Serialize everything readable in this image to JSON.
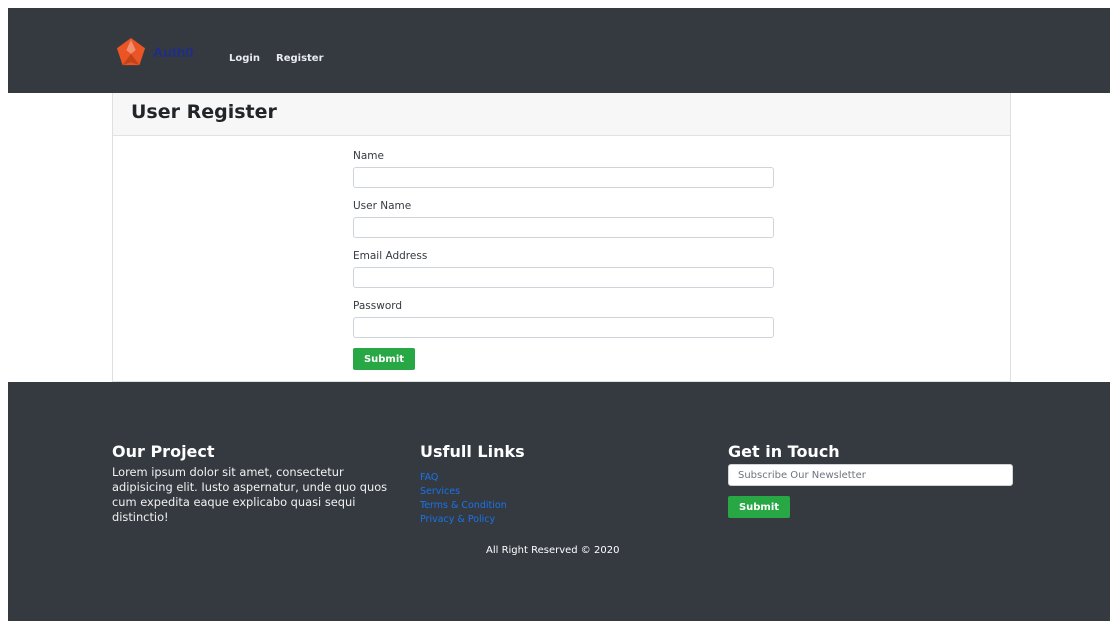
{
  "navbar": {
    "brand": "Auth0",
    "login_label": "Login",
    "register_label": "Register"
  },
  "card": {
    "title": "User Register",
    "fields": [
      {
        "label": "Name",
        "value": ""
      },
      {
        "label": "User Name",
        "value": ""
      },
      {
        "label": "Email Address",
        "value": ""
      },
      {
        "label": "Password",
        "value": ""
      }
    ],
    "submit_label": "Submit"
  },
  "footer": {
    "about_title": "Our Project",
    "about_text": "Lorem ipsum dolor sit amet, consectetur adipisicing elit. Iusto aspernatur, unde quo quos cum expedita eaque explicabo quasi sequi distinctio!",
    "links_title": "Usfull Links",
    "links": [
      "FAQ",
      "Services",
      "Terms & Condition",
      "Privacy & Policy"
    ],
    "contact_title": "Get in Touch",
    "newsletter_placeholder": "Subscribe Our Newsletter",
    "newsletter_submit": "Submit",
    "copyright": "All Right Reserved © 2020"
  },
  "colors": {
    "dark_bg": "#343a40",
    "success": "#28a745",
    "link": "#1a73e8",
    "brand_icon": "#eb5424"
  },
  "icons": {
    "brand": "auth0-logo-icon"
  }
}
